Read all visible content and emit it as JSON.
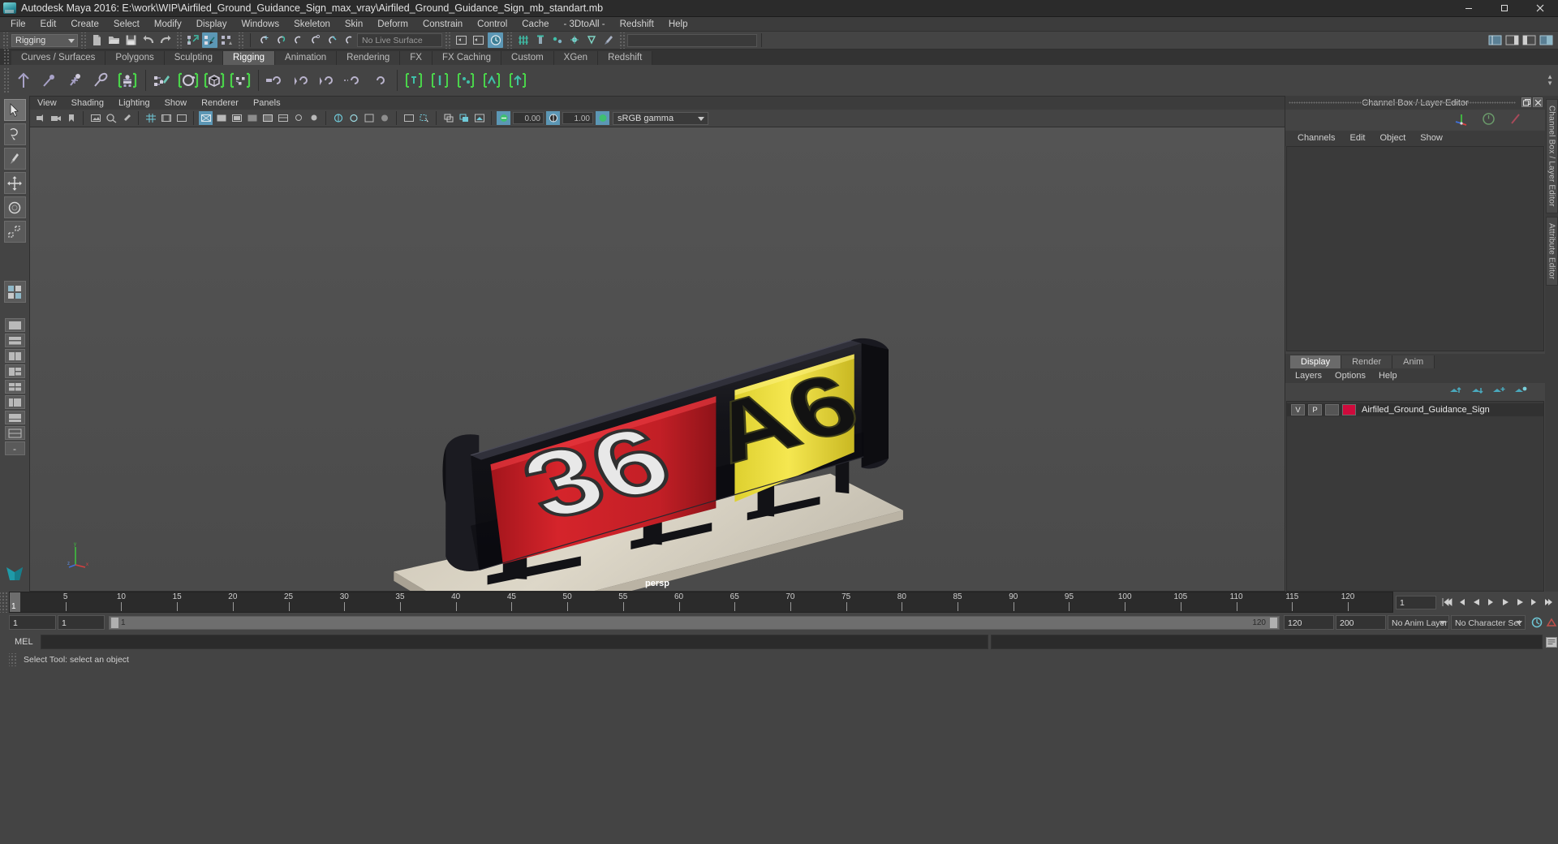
{
  "window": {
    "title": "Autodesk Maya 2016: E:\\work\\WIP\\Airfiled_Ground_Guidance_Sign_max_vray\\Airfiled_Ground_Guidance_Sign_mb_standart.mb",
    "app_icon": "maya-icon",
    "minimize": "–",
    "maximize": "❐",
    "close": "✕"
  },
  "menubar": {
    "items": [
      "File",
      "Edit",
      "Create",
      "Select",
      "Modify",
      "Display",
      "Windows",
      "Skeleton",
      "Skin",
      "Deform",
      "Constrain",
      "Control",
      "Cache",
      "- 3DtoAll -",
      "Redshift",
      "Help"
    ]
  },
  "statusline": {
    "mode": "Rigging",
    "live_surface": "No Live Surface"
  },
  "shelf": {
    "tabs": [
      "Curves / Surfaces",
      "Polygons",
      "Sculpting",
      "Rigging",
      "Animation",
      "Rendering",
      "FX",
      "FX Caching",
      "Custom",
      "XGen",
      "Redshift"
    ],
    "active_tab": "Rigging"
  },
  "viewport_panel": {
    "menus": [
      "View",
      "Shading",
      "Lighting",
      "Show",
      "Renderer",
      "Panels"
    ],
    "exposure": "0.00",
    "gamma": "1.00",
    "color_management": "sRGB gamma",
    "camera_label": "persp"
  },
  "sign": {
    "left_number": "36",
    "right_code": "A6",
    "left_panel_color": "#cf2027",
    "right_panel_color": "#f2e13b",
    "body_color": "#15151a",
    "base_color": "#d8d2c4"
  },
  "right_panel": {
    "title": "Channel Box / Layer Editor",
    "menus": [
      "Channels",
      "Edit",
      "Object",
      "Show"
    ],
    "vertical_tabs": [
      "Channel Box / Layer Editor",
      "Attribute Editor"
    ],
    "layer_tabs": [
      "Display",
      "Render",
      "Anim"
    ],
    "active_layer_tab": "Display",
    "layer_menus": [
      "Layers",
      "Options",
      "Help"
    ],
    "layers": [
      {
        "visibility": "V",
        "playback": "P",
        "type": "",
        "color": "#cf0a3c",
        "name": "Airfiled_Ground_Guidance_Sign"
      }
    ]
  },
  "timeline": {
    "current_frame": "1",
    "ticks": [
      5,
      10,
      15,
      20,
      25,
      30,
      35,
      40,
      45,
      50,
      55,
      60,
      65,
      70,
      75,
      80,
      85,
      90,
      95,
      100,
      105,
      110,
      115,
      120
    ],
    "frame_field": "1",
    "range_start": "1",
    "range_end": "1",
    "slider_start": "1",
    "slider_end": "120",
    "anim_end": "120",
    "playback_end": "200",
    "anim_layer": "No Anim Layer",
    "character_set": "No Character Set"
  },
  "command_line": {
    "label": "MEL",
    "input": "",
    "output": ""
  },
  "status": {
    "message": "Select Tool: select an object"
  }
}
